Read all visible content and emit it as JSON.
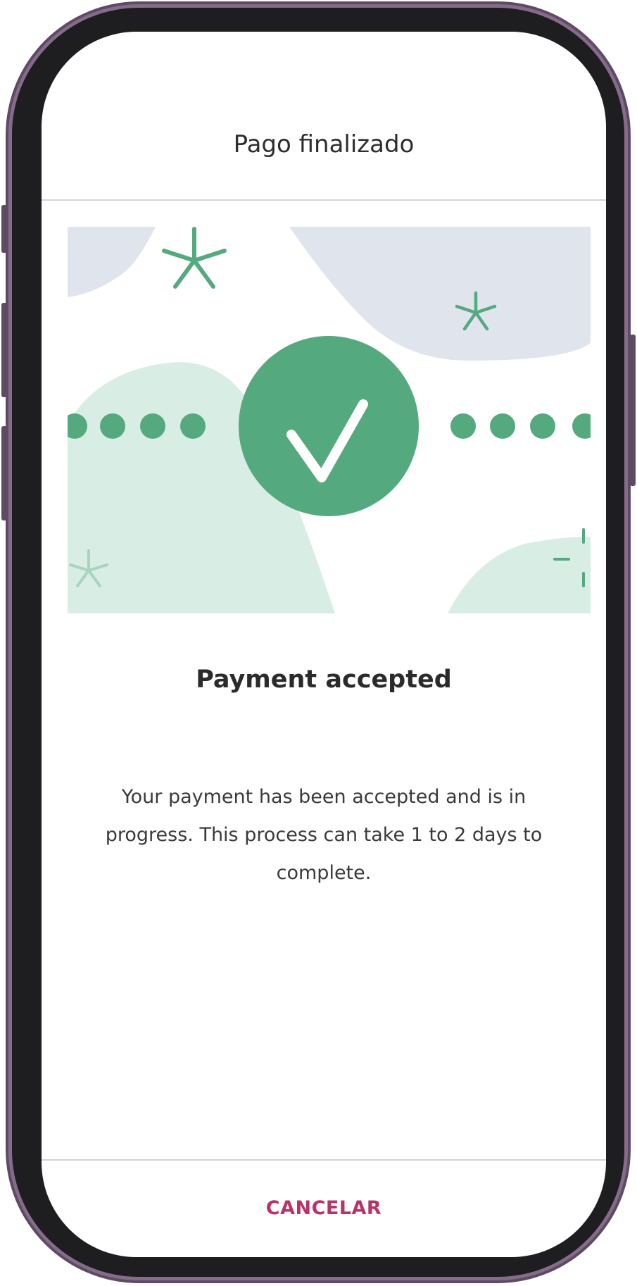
{
  "header": {
    "title": "Pago finalizado"
  },
  "status": {
    "headline": "Payment accepted",
    "message": "Your payment has been accepted and is in progress. This process can take 1 to 2 days to complete.",
    "icon": "checkmark-icon"
  },
  "footer": {
    "cancel_label": "CANCELAR"
  },
  "colors": {
    "accent_green": "#55a97f",
    "light_green": "#d8ede4",
    "light_blue": "#dfe4ed",
    "cancel_pink": "#b8336a",
    "frame_purple": "#866c8b"
  }
}
